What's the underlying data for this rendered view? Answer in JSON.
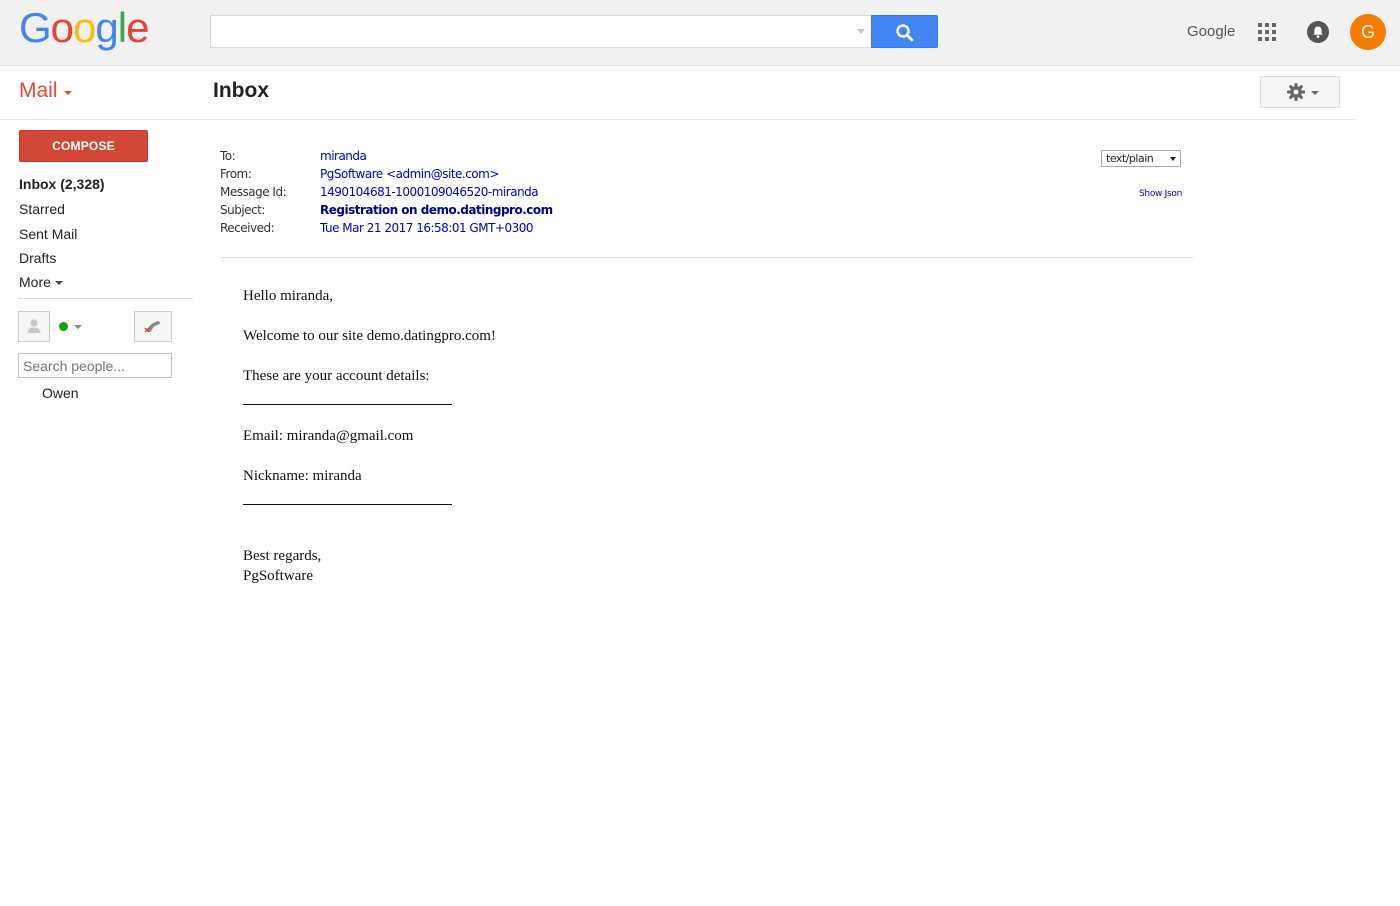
{
  "header": {
    "logo": [
      "G",
      "o",
      "o",
      "g",
      "l",
      "e"
    ],
    "logo_colors": [
      "#4285f4",
      "#ea4335",
      "#fbbc05",
      "#4285f4",
      "#34a853",
      "#ea4335"
    ],
    "search_placeholder": "",
    "google_link": "Google",
    "avatar_letter": "G"
  },
  "subbar": {
    "mail_label": "Mail",
    "title": "Inbox"
  },
  "sidebar": {
    "compose": "COMPOSE",
    "items": [
      {
        "label": "Inbox (2,328)"
      },
      {
        "label": "Starred"
      },
      {
        "label": "Sent Mail"
      },
      {
        "label": "Drafts"
      },
      {
        "label": "More"
      }
    ],
    "people_search_placeholder": "Search people...",
    "contacts": [
      "Owen"
    ]
  },
  "message": {
    "headers": [
      {
        "label": "To:",
        "value": "miranda"
      },
      {
        "label": "From:",
        "value": "PgSoftware <admin@site.com>"
      },
      {
        "label": "Message Id:",
        "value": "1490104681-1000109046520-miranda"
      },
      {
        "label": "Subject:",
        "value": "Registration on demo.datingpro.com"
      },
      {
        "label": "Received:",
        "value": "Tue Mar 21 2017 16:58:01 GMT+0300"
      }
    ],
    "format": "text/plain",
    "show_json": "Show Json",
    "body": {
      "greeting": "Hello miranda,",
      "welcome": "Welcome to our site demo.datingpro.com!",
      "details_intro": "These are your account details:",
      "email": "Email: miranda@gmail.com",
      "nickname": "Nickname: miranda",
      "regards": "Best regards,",
      "signature": "PgSoftware"
    }
  }
}
